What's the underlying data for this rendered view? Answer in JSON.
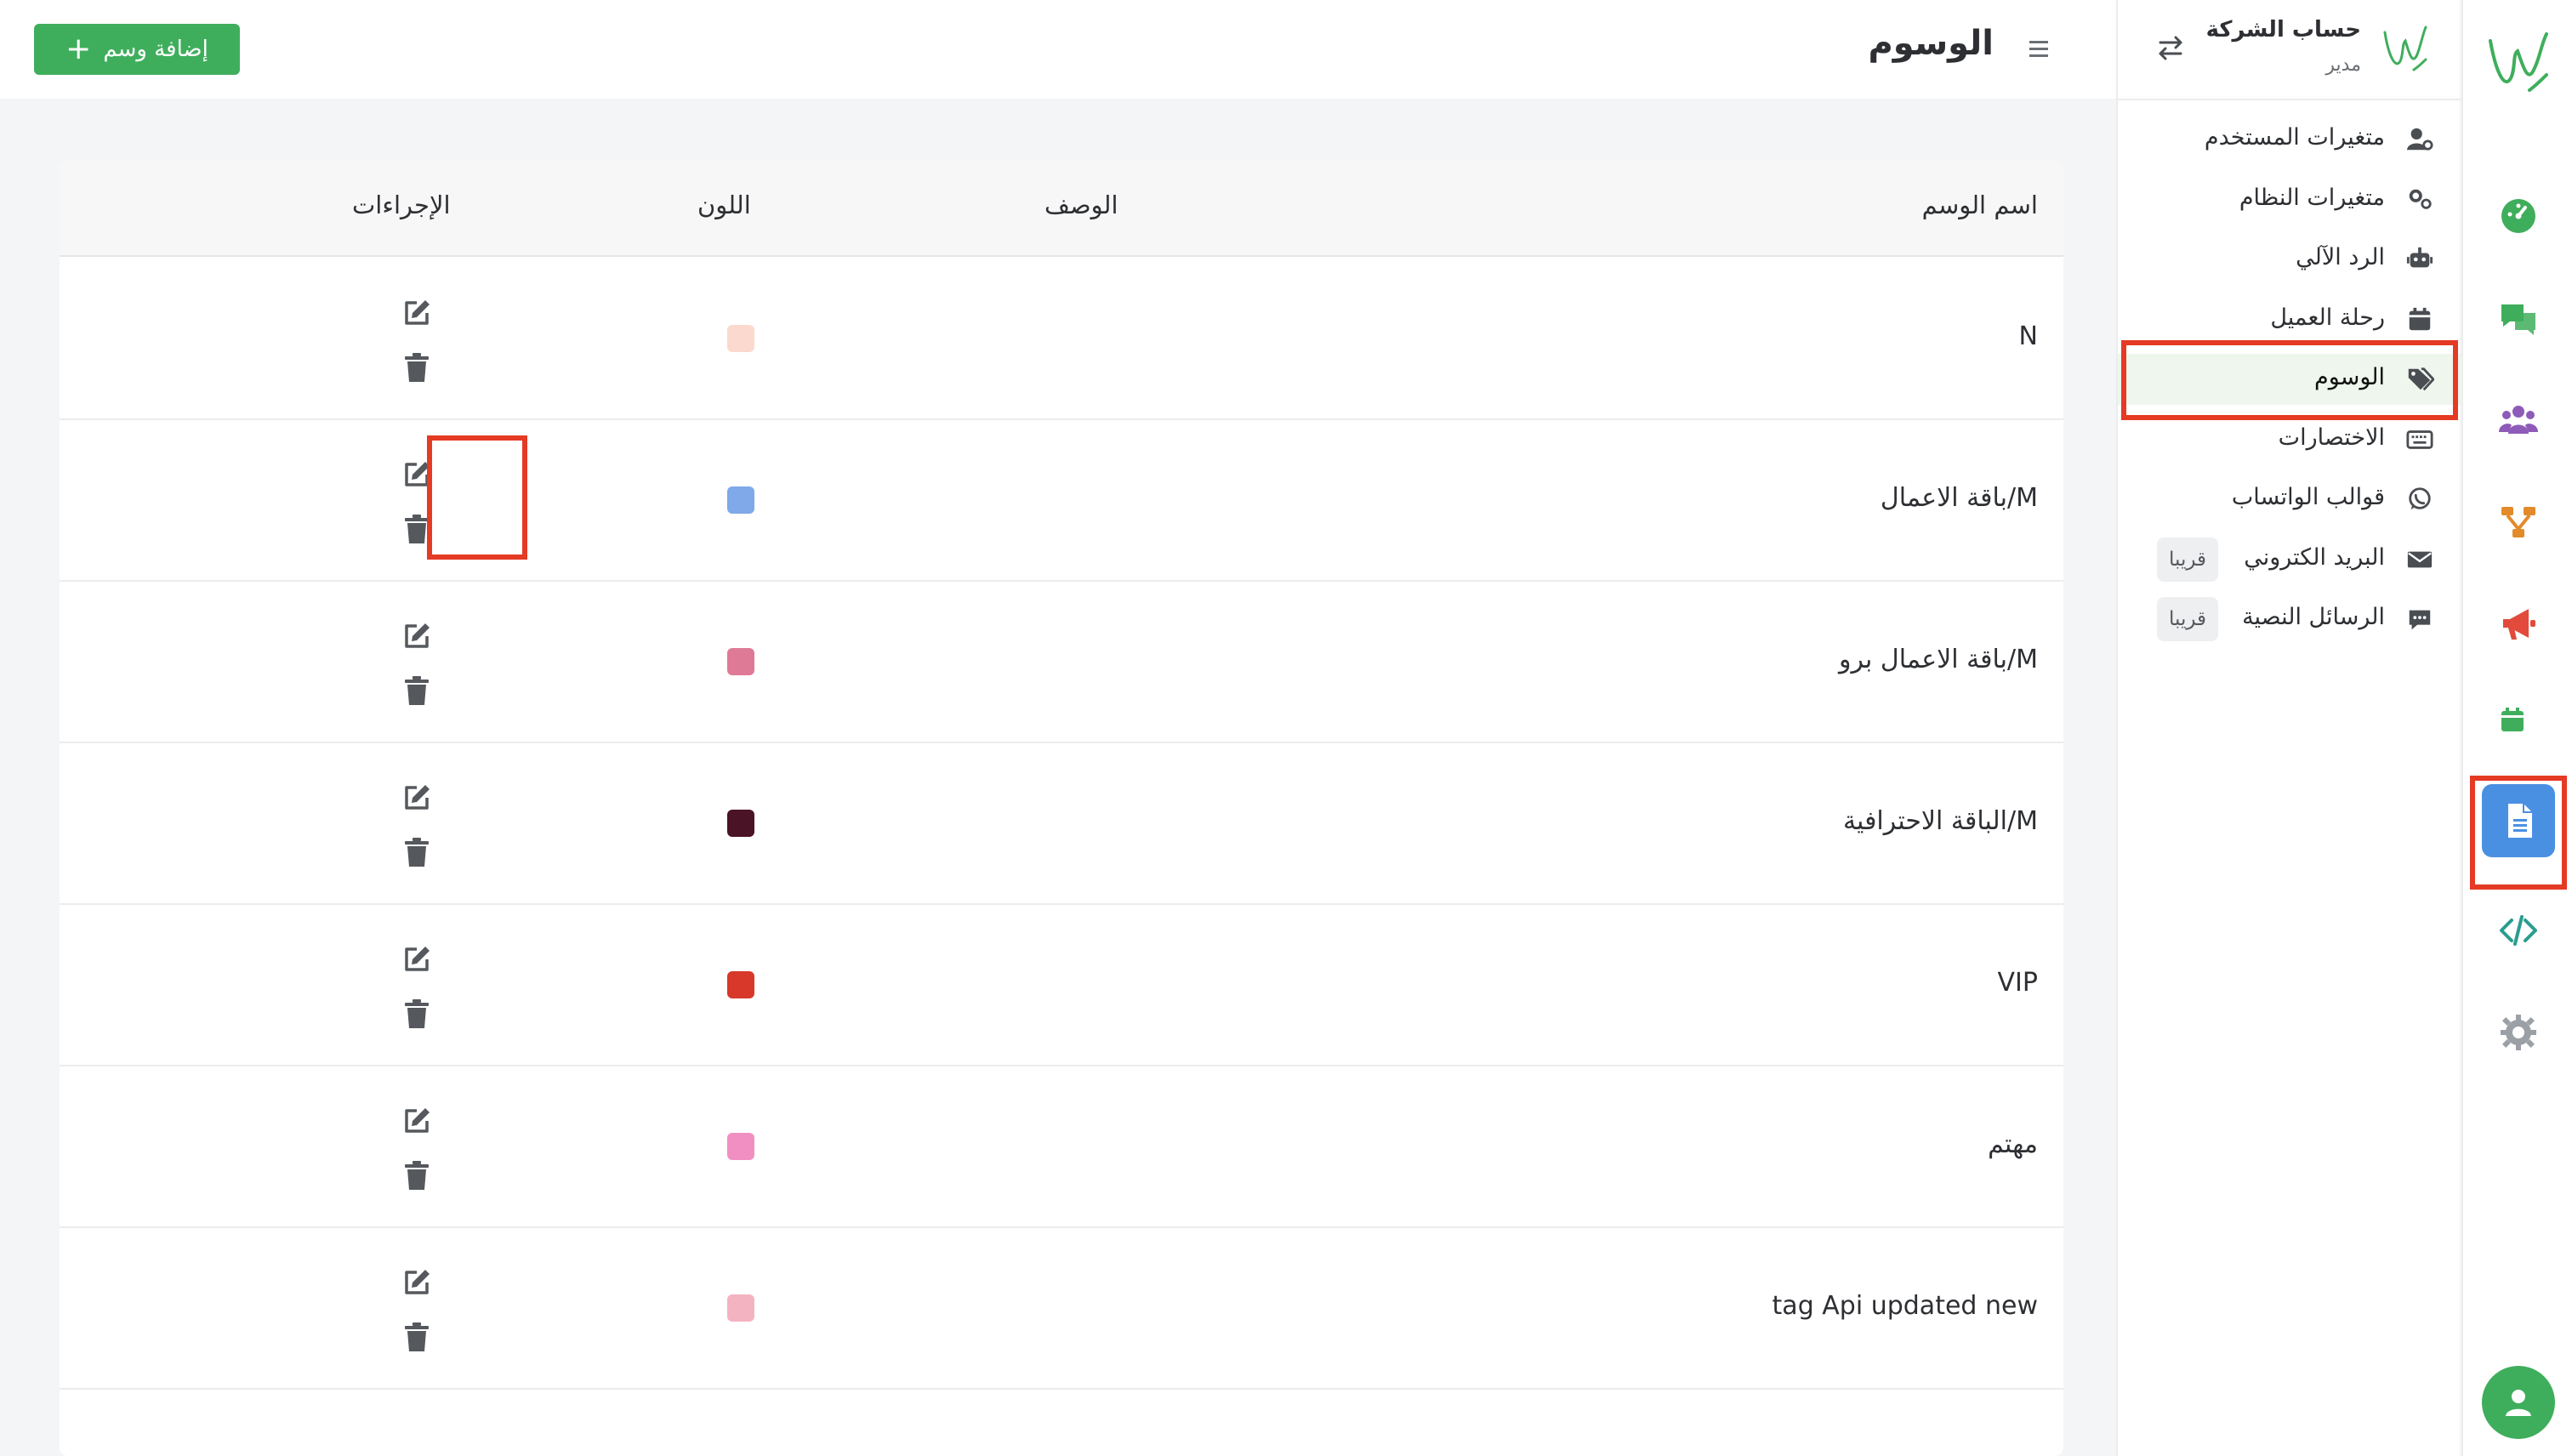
{
  "header": {
    "title": "الوسوم",
    "add_button_label": "إضافة وسم"
  },
  "account": {
    "name": "حساب الشركة",
    "role": "مدير"
  },
  "sidebar": {
    "items": [
      {
        "label": "متغيرات المستخدم",
        "icon": "user-cog-icon"
      },
      {
        "label": "متغيرات النظام",
        "icon": "cogs-icon"
      },
      {
        "label": "الرد الآلي",
        "icon": "robot-icon"
      },
      {
        "label": "رحلة العميل",
        "icon": "calendar-icon"
      },
      {
        "label": "الوسوم",
        "icon": "tags-icon",
        "active": true
      },
      {
        "label": "الاختصارات",
        "icon": "keyboard-icon"
      },
      {
        "label": "قوالب الواتساب",
        "icon": "whatsapp-icon"
      },
      {
        "label": "البريد الكتروني",
        "icon": "envelope-icon",
        "badge": "قريبا"
      },
      {
        "label": "الرسائل النصية",
        "icon": "sms-icon",
        "badge": "قريبا"
      }
    ]
  },
  "rail": {
    "items": [
      {
        "icon": "dashboard-icon",
        "color": "#3fae5c"
      },
      {
        "icon": "chat-icon",
        "color": "#3fae5c"
      },
      {
        "icon": "users-icon",
        "color": "#8e5bb8"
      },
      {
        "icon": "flow-icon",
        "color": "#e38a2a"
      },
      {
        "icon": "megaphone-icon",
        "color": "#e24b3b"
      },
      {
        "icon": "calendar-icon",
        "color": "#3fae5c"
      },
      {
        "icon": "document-icon",
        "color": "#ffffff",
        "active": true
      },
      {
        "icon": "code-icon",
        "color": "#2a9d8f"
      },
      {
        "icon": "gear-icon",
        "color": "#9aa0a6"
      }
    ]
  },
  "table": {
    "columns": {
      "name": "اسم الوسم",
      "description": "الوصف",
      "color": "اللون",
      "actions": "الإجراءات"
    },
    "rows": [
      {
        "name": "N",
        "description": "",
        "color": "#fbd9cf"
      },
      {
        "name": "باقة الاعمال/M",
        "description": "",
        "color": "#7fa9e8"
      },
      {
        "name": "باقة الاعمال برو/M",
        "description": "",
        "color": "#df7a96"
      },
      {
        "name": "الباقة الاحترافية/M",
        "description": "",
        "color": "#4a1326"
      },
      {
        "name": "VIP",
        "description": "",
        "color": "#d7382a"
      },
      {
        "name": "مهتم",
        "description": "",
        "color": "#f28fc2"
      },
      {
        "name": "tag Api updated new",
        "description": "",
        "color": "#f4b3c1"
      }
    ]
  }
}
